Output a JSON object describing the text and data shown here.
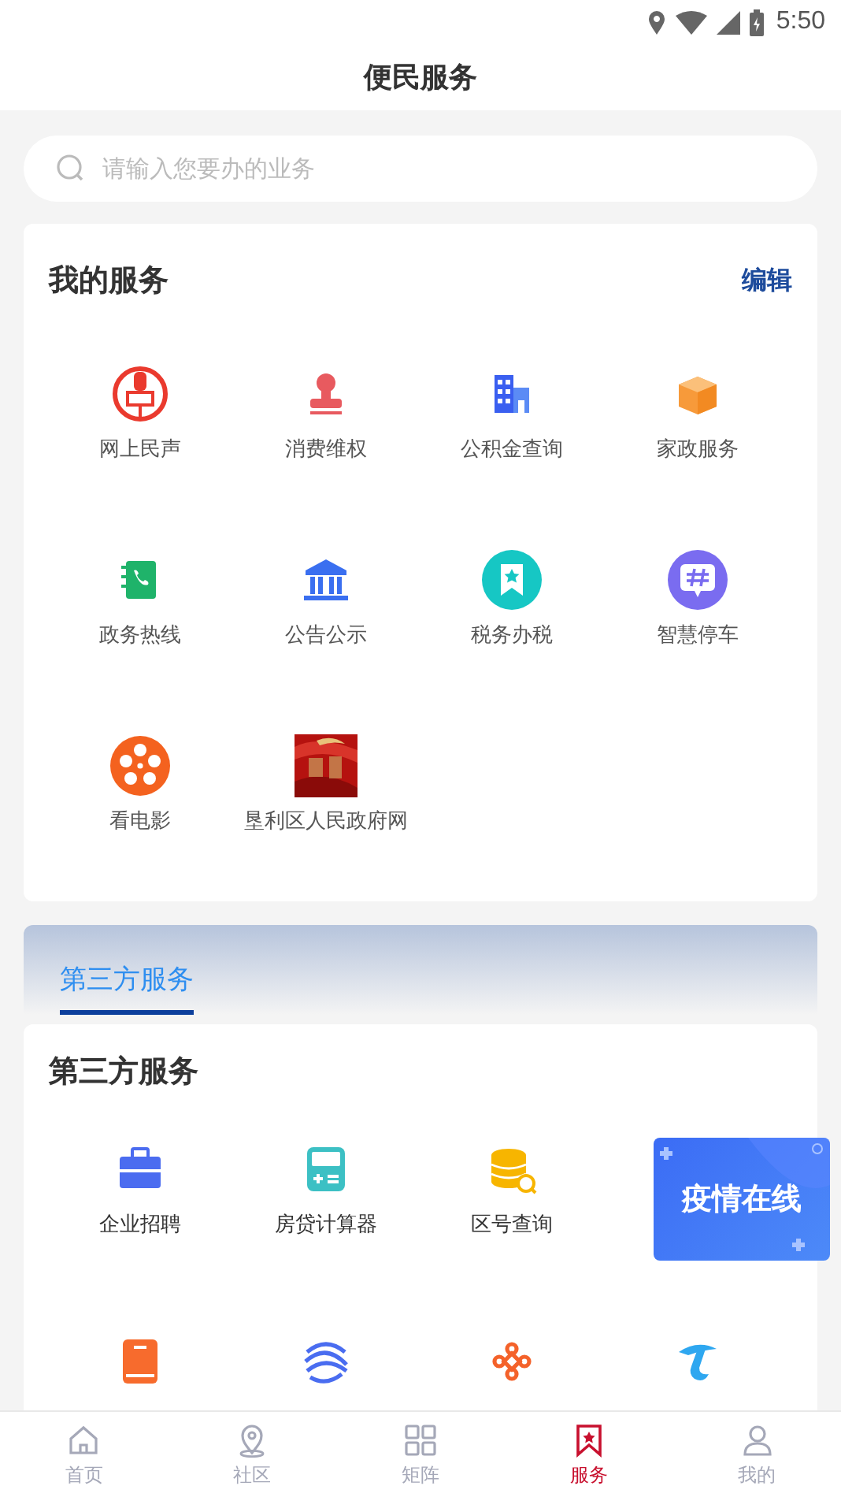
{
  "status_bar": {
    "time": "5:50"
  },
  "header": {
    "title": "便民服务"
  },
  "search": {
    "placeholder": "请输入您要办的业务"
  },
  "my_services": {
    "title": "我的服务",
    "edit_link": "编辑",
    "items": [
      {
        "label": "网上民声"
      },
      {
        "label": "消费维权"
      },
      {
        "label": "公积金查询"
      },
      {
        "label": "家政服务"
      },
      {
        "label": "政务热线"
      },
      {
        "label": "公告公示"
      },
      {
        "label": "税务办税"
      },
      {
        "label": "智慧停车"
      },
      {
        "label": "看电影"
      },
      {
        "label": "垦利区人民政府网",
        "kind": "picture"
      }
    ]
  },
  "tabs": [
    {
      "label": "第三方服务",
      "selected": true
    }
  ],
  "third_party": {
    "title": "第三方服务",
    "items": [
      {
        "kind": "labeled",
        "label": "企业招聘"
      },
      {
        "kind": "labeled",
        "label": "房贷计算器"
      },
      {
        "kind": "labeled",
        "label": "区号查询"
      },
      {
        "kind": "covered"
      },
      {
        "kind": "label_cut_off"
      },
      {
        "kind": "label_cut_off"
      },
      {
        "kind": "label_cut_off"
      },
      {
        "kind": "label_cut_off"
      }
    ]
  },
  "floating_banner": {
    "text": "疫情在线"
  },
  "bottom_nav": [
    {
      "label": "首页",
      "selected": false
    },
    {
      "label": "社区",
      "selected": false
    },
    {
      "label": "矩阵",
      "selected": false
    },
    {
      "label": "服务",
      "selected": true
    },
    {
      "label": "我的",
      "selected": false
    }
  ]
}
